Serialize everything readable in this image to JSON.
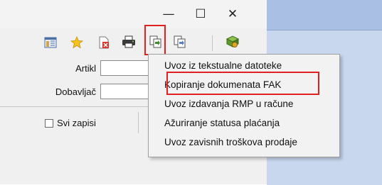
{
  "window": {
    "controls": {
      "minimize": "—",
      "maximize": "☐",
      "close": "✕"
    }
  },
  "toolbar": {
    "icons": [
      "columns-icon",
      "star-icon",
      "delete-document-icon",
      "print-icon",
      "copy-documents-icon",
      "import-documents-icon",
      "export-icon"
    ],
    "highlight_color": "#e32020"
  },
  "form": {
    "artikl_label": "Artikl",
    "dobavljac_label": "Dobavljač",
    "svi_zapisi_label": "Svi zapisi"
  },
  "context_menu": {
    "items": [
      "Uvoz iz tekstualne datoteke",
      "Kopiranje dokumenata FAK",
      "Uvoz izdavanja RMP u račune",
      "Ažuriranje statusa plaćanja",
      "Uvoz zavisnih troškova prodaje"
    ],
    "highlighted_index": 1
  },
  "colors": {
    "background_blue": "#a9bfe3",
    "window": "#f0f0f0",
    "highlight": "#e32020"
  }
}
